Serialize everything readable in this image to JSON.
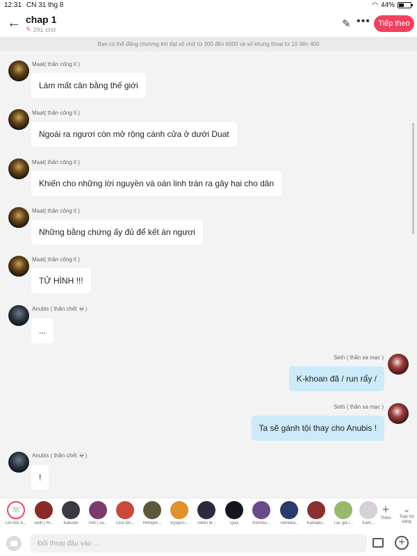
{
  "status_bar": {
    "time": "12:31",
    "date": "CN 31 thg 8",
    "battery": "44%"
  },
  "header": {
    "title": "chap 1",
    "word_count": "291 chữ",
    "next_label": "Tiếp theo"
  },
  "notice": "Bạn có thể đăng chương khi đạt số chữ từ 300 đến 6000 và số khung thoại từ 10 đến 400",
  "messages": [
    {
      "sender": "Maat( thần công lí )",
      "text": "Làm mất cân bằng thế giới"
    },
    {
      "sender": "Maat( thần công lí )",
      "text": "Ngoài ra ngươi còn mở rộng cánh cửa ở dưới Duat"
    },
    {
      "sender": "Maat( thần công lí )",
      "text": "Khiến cho những lời nguyền và oán linh tràn ra gây hại cho dân"
    },
    {
      "sender": "Maat( thần công lí )",
      "text": "Những bằng chứng ấy đủ để kết án ngươi"
    },
    {
      "sender": "Maat( thần công lí )",
      "text": "TỬ HÌNH !!!"
    },
    {
      "sender": "Anubis ( thần chết 💀)",
      "text": "..."
    },
    {
      "sender": "Seth ( thần sa mạc )",
      "text": "K-khoan đã / run rẩy /"
    },
    {
      "sender": "Seth ( thần sa mạc )",
      "text": "Ta sẽ gánh tội thay cho Anubis !"
    },
    {
      "sender": "Anubis ( thần chết 💀)",
      "text": "!"
    }
  ],
  "characters": [
    {
      "name": "Lời bốc b...",
      "color": "#ffffff"
    },
    {
      "name": "Seth ( th...",
      "color": "#8a2a2a"
    },
    {
      "name": "Kakushi",
      "color": "#3a3a44"
    },
    {
      "name": "039 ( xà...",
      "color": "#7a3b6e"
    },
    {
      "name": "Uzui ten...",
      "color": "#c84a3a"
    },
    {
      "name": "Himejim...",
      "color": "#5a5a3a"
    },
    {
      "name": "Kyojuro...",
      "color": "#e0912a"
    },
    {
      "name": "Tokito M...",
      "color": "#2a2a40"
    },
    {
      "name": "Qua",
      "color": "#151520"
    },
    {
      "name": "Kochou...",
      "color": "#6a4a8a"
    },
    {
      "name": "Tomioka...",
      "color": "#2a3a6a"
    },
    {
      "name": "Kamado...",
      "color": "#8a3030"
    },
    {
      "name": "Tác giả /...",
      "color": "#9ab86a"
    },
    {
      "name": "Kam...",
      "color": "#d8d0d8"
    }
  ],
  "charbar": {
    "add_label": "Thêm",
    "all_label": "Toàn bộ bảng"
  },
  "input": {
    "placeholder": "Đối thoại đầu vào ..."
  },
  "accent_color": "#f0415f"
}
